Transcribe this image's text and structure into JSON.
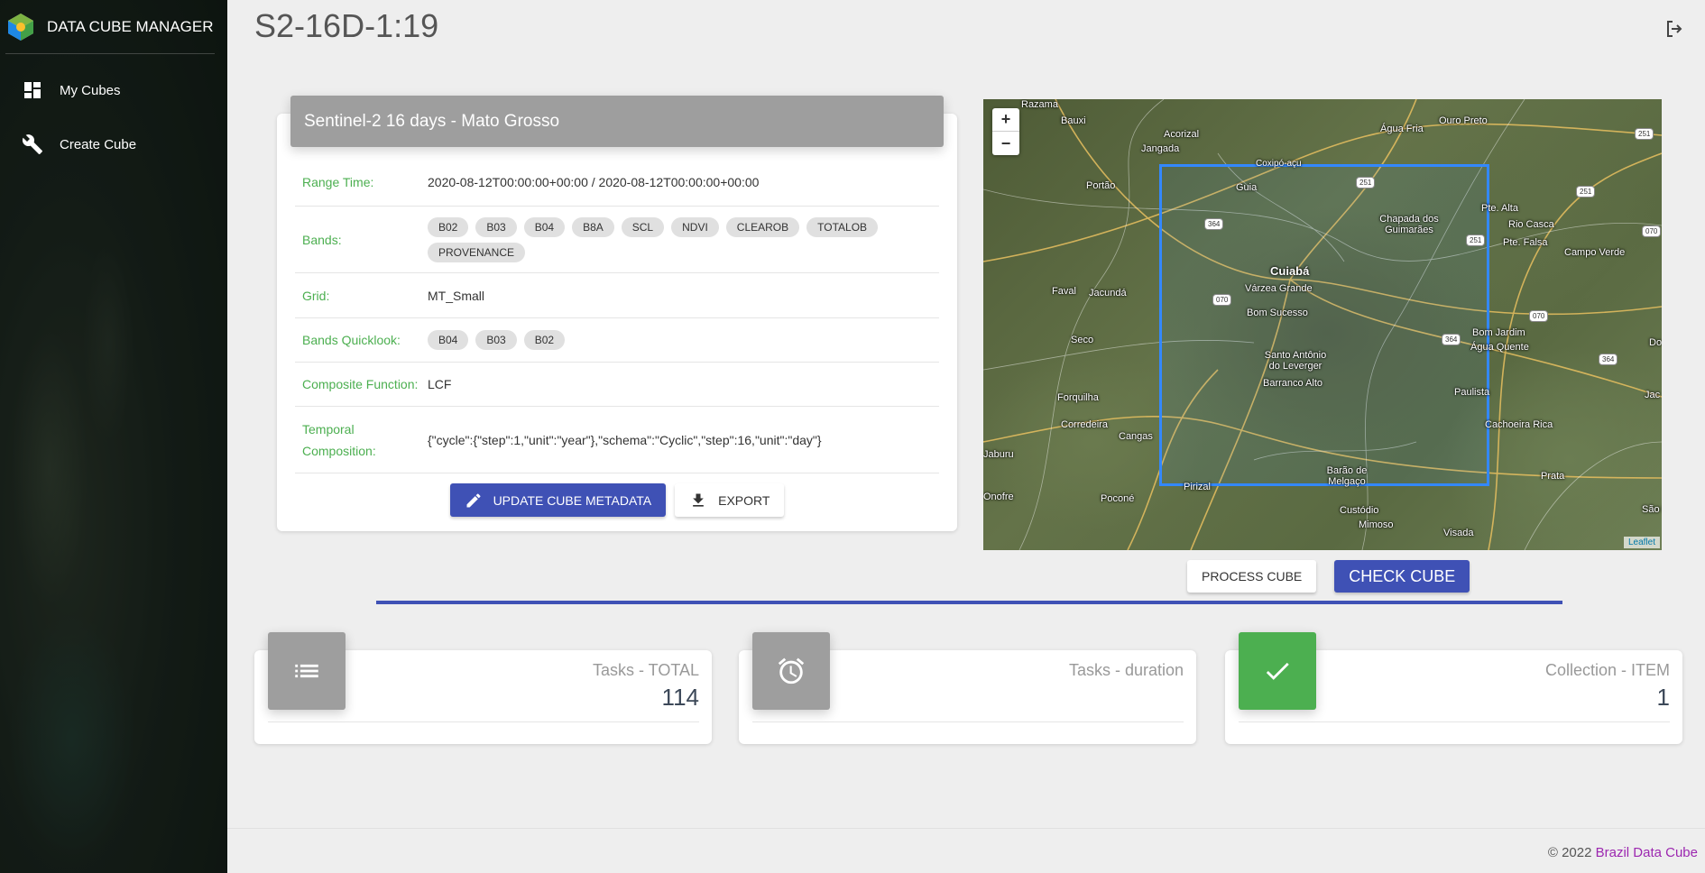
{
  "app": {
    "brand": "DATA CUBE MANAGER"
  },
  "sidebar": {
    "items": [
      {
        "label": "My Cubes",
        "icon": "dashboard-icon"
      },
      {
        "label": "Create Cube",
        "icon": "wrench-icon"
      }
    ]
  },
  "page": {
    "title": "S2-16D-1:19"
  },
  "cube": {
    "header": "Sentinel-2 16 days - Mato Grosso",
    "rows": {
      "range_time": {
        "label": "Range Time:",
        "value": "2020-08-12T00:00:00+00:00 / 2020-08-12T00:00:00+00:00"
      },
      "bands": {
        "label": "Bands:",
        "values": [
          "B02",
          "B03",
          "B04",
          "B8A",
          "SCL",
          "NDVI",
          "CLEAROB",
          "TOTALOB",
          "PROVENANCE"
        ]
      },
      "grid": {
        "label": "Grid:",
        "value": "MT_Small"
      },
      "quicklook": {
        "label": "Bands Quicklook:",
        "values": [
          "B04",
          "B03",
          "B02"
        ]
      },
      "composite": {
        "label": "Composite Function:",
        "value": "LCF"
      },
      "temporal": {
        "label": "Temporal Composition:",
        "value": "{\"cycle\":{\"step\":1,\"unit\":\"year\"},\"schema\":\"Cyclic\",\"step\":16,\"unit\":\"day\"}"
      }
    },
    "buttons": {
      "update": "UPDATE CUBE METADATA",
      "export": "EXPORT"
    }
  },
  "map": {
    "zoom_in": "+",
    "zoom_out": "−",
    "attribution": "Leaflet",
    "labels": [
      "Razama",
      "Bauxi",
      "Acorizal",
      "Jangada",
      "Coxipó-açu",
      "Água Fria",
      "Ouro Preto",
      "Portão",
      "Guia",
      "Chapada dos Guimarães",
      "Pte. Alta",
      "Rio Casca",
      "Pte. Falsa",
      "Campo Verde",
      "Cuiabá",
      "Várzea Grande",
      "Faval",
      "Jacundá",
      "Bom Sucesso",
      "Seco",
      "Bom Jardim",
      "Água Quente",
      "Santo Antônio do Leverger",
      "Barranco Alto",
      "Forquilha",
      "Paulista",
      "Corredeira",
      "Cangas",
      "Cachoeira Rica",
      "Jaburu",
      "Barão de Melgaço",
      "Prata",
      "Onofre",
      "Poconé",
      "Pirizal",
      "Custódio",
      "Mimoso",
      "Visada",
      "São D",
      "Jac",
      "Do"
    ],
    "shields": [
      "251",
      "251",
      "251",
      "364",
      "070",
      "251",
      "070",
      "070",
      "364",
      "364",
      "070"
    ]
  },
  "actions": {
    "process": "PROCESS CUBE",
    "check": "CHECK CUBE"
  },
  "stats": [
    {
      "label": "Tasks - TOTAL",
      "value": "114",
      "icon": "list-icon",
      "color": "#9e9e9e"
    },
    {
      "label": "Tasks - duration",
      "value": "",
      "icon": "alarm-clock-icon",
      "color": "#9e9e9e"
    },
    {
      "label": "Collection - ITEM",
      "value": "1",
      "icon": "check-icon",
      "color": "#4caf50"
    }
  ],
  "footer": {
    "copyright": "© 2022 ",
    "link": "Brazil Data Cube"
  }
}
